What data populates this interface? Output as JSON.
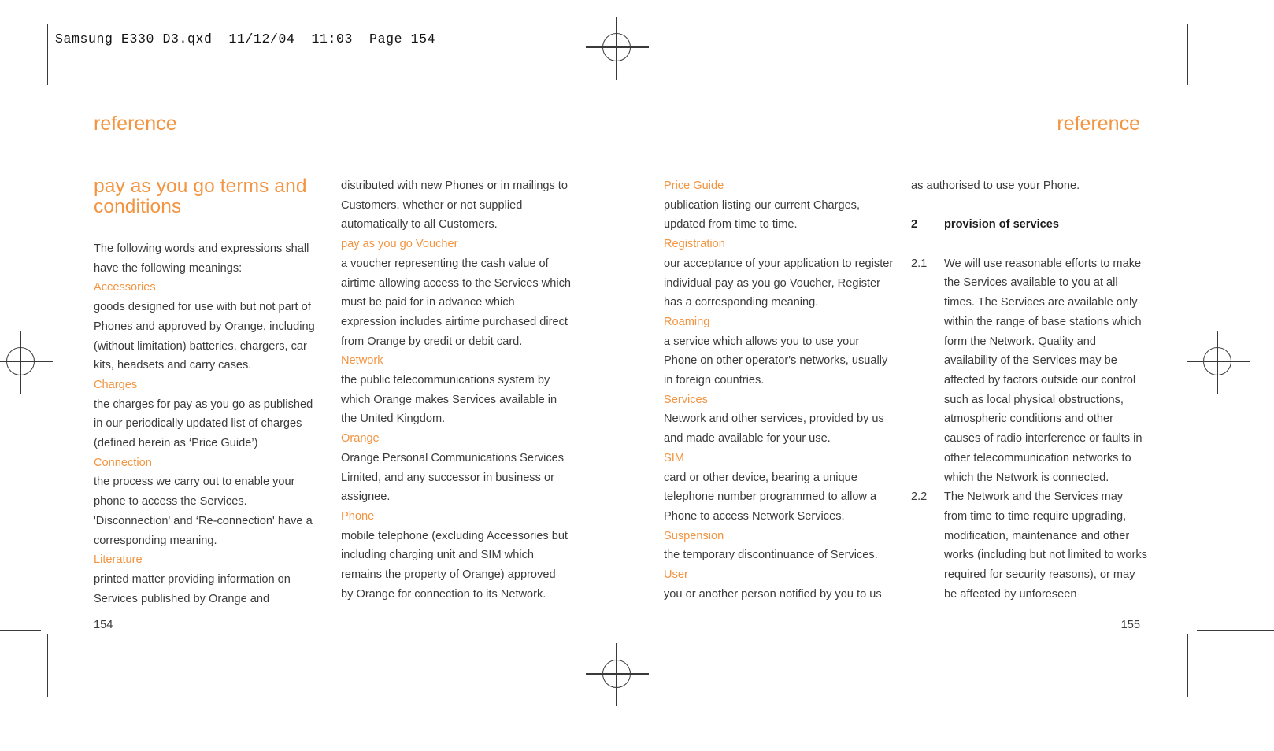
{
  "slug": "Samsung E330 D3.qxd  11/12/04  11:03  Page 154",
  "accent_color": "#f29440",
  "text_color": "#3b3b3b",
  "running_head": {
    "left": "reference",
    "right": "reference"
  },
  "folios": {
    "left": "154",
    "right": "155"
  },
  "section_title": "pay as you go terms and conditions",
  "columns": {
    "col1": {
      "intro": "The following words and expressions shall have the following meanings:",
      "entries": [
        {
          "term": "Accessories",
          "definition": "goods designed for use with but not part of Phones and approved by Orange, including (without limitation) batteries, chargers, car kits, headsets and carry cases."
        },
        {
          "term": "Charges",
          "definition": "the charges for pay as you go as published in our periodically updated list of charges (defined herein as ‘Price Guide’)"
        },
        {
          "term": "Connection",
          "definition": "the process we carry out to enable your phone to access the Services. 'Disconnection' and ‘Re-connection' have a corresponding meaning."
        },
        {
          "term": "Literature",
          "definition": "printed matter providing information on Services published by Orange and"
        }
      ]
    },
    "col2": {
      "continuation": "distributed with new Phones or in mailings to Customers, whether or not supplied automatically to all Customers.",
      "entries": [
        {
          "term": "pay as you go Voucher",
          "definition": "a voucher representing the cash value of airtime allowing access to the Services which must be paid for in advance which expression includes airtime purchased direct from Orange by credit or debit card."
        },
        {
          "term": "Network",
          "definition": "the public telecommunications system by which Orange makes Services available in the United Kingdom."
        },
        {
          "term": "Orange",
          "definition": "Orange Personal Communications Services Limited, and any successor in business or assignee."
        },
        {
          "term": "Phone",
          "definition": "mobile telephone (excluding Accessories but including charging unit and SIM which remains the property of Orange) approved by Orange for connection to its Network."
        }
      ]
    },
    "col3": {
      "entries": [
        {
          "term": "Price Guide",
          "definition": "publication listing our current Charges, updated from time to time."
        },
        {
          "term": "Registration",
          "definition": "our acceptance of your application to register individual pay as you go Voucher, Register has a corresponding meaning."
        },
        {
          "term": "Roaming",
          "definition": "a service which allows you to use your Phone on other operator's networks, usually in foreign countries."
        },
        {
          "term": "Services",
          "definition": "Network and other services, provided by us and made available for your use."
        },
        {
          "term": "SIM",
          "definition": "card or other device, bearing a unique telephone number programmed to allow a Phone to access Network Services."
        },
        {
          "term": "Suspension",
          "definition": "the temporary discontinuance of Services."
        },
        {
          "term": "User",
          "definition": "you or another person notified by you to us"
        }
      ]
    },
    "col4": {
      "continuation": "as authorised to use your Phone.",
      "heading": {
        "number": "2",
        "label": "provision of services"
      },
      "clauses": [
        {
          "number": "2.1",
          "text": "We will use reasonable efforts to make the Services available to you at all times. The Services are available only within the range of base stations which form the Network. Quality and availability of the Services may be affected by factors outside our control such as local physical obstructions, atmospheric conditions and other causes of radio interference or faults in other telecommunication networks to which the Network is connected."
        },
        {
          "number": "2.2",
          "text": "The Network and the Services may from time to time require upgrading, modification, maintenance and other works (including but not limited to works required for security reasons), or may be affected by unforeseen"
        }
      ]
    }
  }
}
